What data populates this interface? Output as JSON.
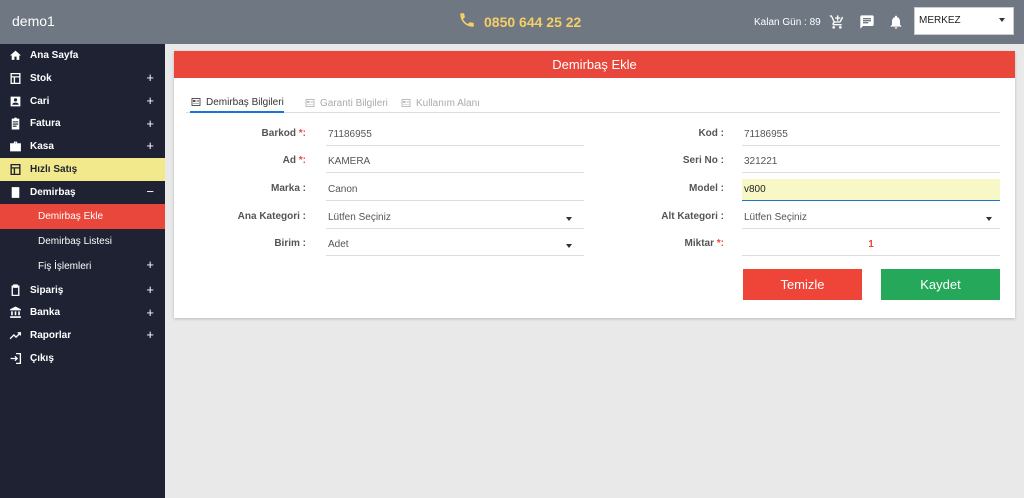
{
  "header": {
    "app_name": "demo1",
    "phone": "0850 644 25 22",
    "remaining_days": "Kalan Gün : 89",
    "branch_select": "MERKEZ",
    "colors": {
      "bar": "#6f7782",
      "phone": "#f5cf66"
    }
  },
  "sidebar": {
    "items": [
      {
        "label": "Ana Sayfa",
        "icon": "home-icon",
        "expand": ""
      },
      {
        "label": "Stok",
        "icon": "stock-icon",
        "expand": "+"
      },
      {
        "label": "Cari",
        "icon": "account-icon",
        "expand": "+"
      },
      {
        "label": "Fatura",
        "icon": "invoice-icon",
        "expand": "+"
      },
      {
        "label": "Kasa",
        "icon": "cash-icon",
        "expand": "+"
      },
      {
        "label": "Hızlı Satış",
        "icon": "quick-sale-icon",
        "expand": ""
      },
      {
        "label": "Demirbaş",
        "icon": "fixture-icon",
        "expand": "−"
      },
      {
        "label": "Demirbaş Ekle"
      },
      {
        "label": "Demirbaş Listesi"
      },
      {
        "label": "Fiş İşlemleri",
        "expand": "+"
      },
      {
        "label": "Sipariş",
        "icon": "order-icon",
        "expand": "+"
      },
      {
        "label": "Banka",
        "icon": "bank-icon",
        "expand": "+"
      },
      {
        "label": "Raporlar",
        "icon": "report-icon",
        "expand": "+"
      },
      {
        "label": "Çıkış",
        "icon": "logout-icon",
        "expand": ""
      }
    ]
  },
  "card": {
    "title": "Demirbaş Ekle",
    "tabs": [
      "Demirbaş Bilgileri",
      "Garanti Bilgileri",
      "Kullanım Alanı"
    ],
    "left": {
      "barkod_label": "Barkod ",
      "barkod_value": "71186955",
      "ad_label": "Ad ",
      "ad_value": "KAMERA",
      "marka_label": "Marka :",
      "marka_value": "Canon",
      "ana_kategori_label": "Ana Kategori :",
      "ana_kategori_value": "Lütfen Seçiniz",
      "birim_label": "Birim :",
      "birim_value": "Adet"
    },
    "right": {
      "kod_label": "Kod :",
      "kod_value": "71186955",
      "seri_label": "Seri No :",
      "seri_value": "321221",
      "model_label": "Model :",
      "model_value": "v800",
      "alt_kategori_label": "Alt Kategori :",
      "alt_kategori_value": "Lütfen Seçiniz",
      "miktar_label": "Miktar ",
      "miktar_value": "1"
    },
    "required_mark": "*:",
    "buttons": {
      "clear": "Temizle",
      "save": "Kaydet"
    },
    "colors": {
      "header": "#e9473b",
      "save": "#26a85a",
      "clear": "#ef4438"
    }
  }
}
